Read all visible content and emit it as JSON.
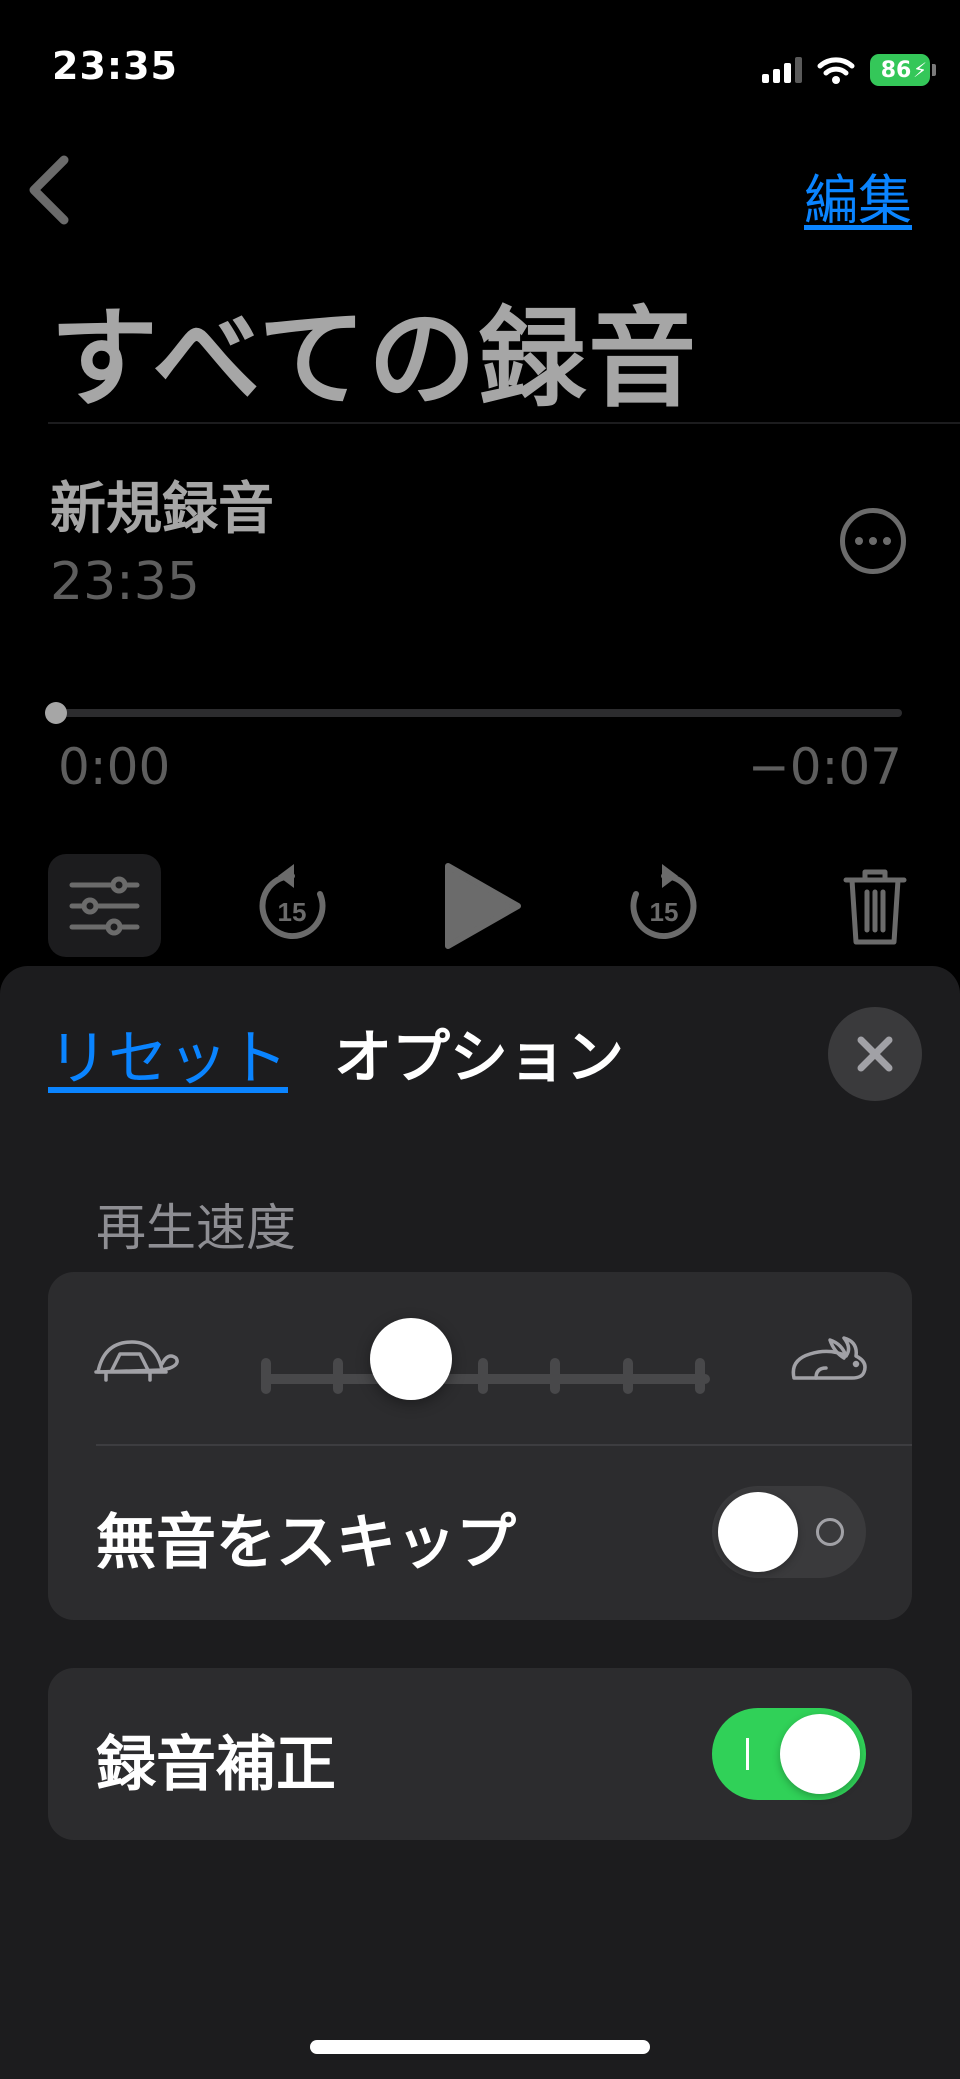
{
  "status_bar": {
    "time": "23:35",
    "battery_level": "86",
    "charging": true
  },
  "nav": {
    "back_icon": "chevron-left-icon",
    "edit_label": "編集"
  },
  "page_title": "すべての録音",
  "recording": {
    "name": "新規録音",
    "time": "23:35",
    "elapsed": "0:00",
    "remaining": "−0:07",
    "playback_progress": 0
  },
  "transport": {
    "options_icon": "sliders-icon",
    "skip_back_icon": "skip-back-15-icon",
    "play_icon": "play-icon",
    "skip_forward_icon": "skip-forward-15-icon",
    "delete_icon": "trash-icon"
  },
  "options_sheet": {
    "reset_label": "リセット",
    "title": "オプション",
    "close_icon": "close-icon",
    "speed_section_label": "再生速度",
    "speed_slider": {
      "stops": 7,
      "selected_stop": 2,
      "slow_icon": "turtle-icon",
      "fast_icon": "rabbit-icon"
    },
    "skip_silence": {
      "label": "無音をスキップ",
      "enabled": false
    },
    "enhance_recording": {
      "label": "録音補正",
      "enabled": true
    }
  },
  "colors": {
    "accent": "#0a84ff",
    "toggle_on": "#30d158",
    "battery": "#34c759"
  }
}
